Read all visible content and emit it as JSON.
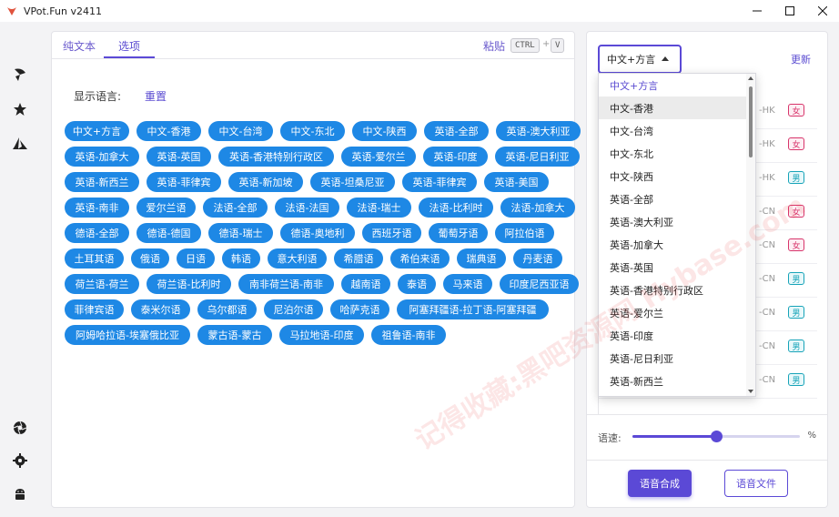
{
  "window": {
    "title": "VPot.Fun v2411",
    "controls": [
      "minimize",
      "maximize",
      "close"
    ]
  },
  "rail": {
    "icons": [
      "pinwheel-icon",
      "star-icon",
      "azure-icon",
      "aperture-icon",
      "gear-icon",
      "android-icon"
    ]
  },
  "main": {
    "tabs": [
      {
        "label": "纯文本"
      },
      {
        "label": "选项"
      }
    ],
    "paste_label": "粘贴",
    "paste_keys": [
      "CTRL",
      "V"
    ],
    "paste_plus": "+",
    "display_language_label": "显示语言:",
    "reset_label": "重置",
    "chips": [
      [
        "中文+方言",
        "中文-香港",
        "中文-台湾",
        "中文-东北",
        "中文-陕西",
        "英语-全部",
        "英语-澳大利亚"
      ],
      [
        "英语-加拿大",
        "英语-英国",
        "英语-香港特别行政区",
        "英语-爱尔兰",
        "英语-印度",
        "英语-尼日利亚"
      ],
      [
        "英语-新西兰",
        "英语-菲律宾",
        "英语-新加坡",
        "英语-坦桑尼亚",
        "英语-菲律宾",
        "英语-美国"
      ],
      [
        "英语-南非",
        "爱尔兰语",
        "法语-全部",
        "法语-法国",
        "法语-瑞士",
        "法语-比利时",
        "法语-加拿大"
      ],
      [
        "德语-全部",
        "德语-德国",
        "德语-瑞士",
        "德语-奥地利",
        "西班牙语",
        "葡萄牙语",
        "阿拉伯语"
      ],
      [
        "土耳其语",
        "俄语",
        "日语",
        "韩语",
        "意大利语",
        "希腊语",
        "希伯来语",
        "瑞典语",
        "丹麦语"
      ],
      [
        "荷兰语-荷兰",
        "荷兰语-比利时",
        "南非荷兰语-南非",
        "越南语",
        "泰语",
        "马来语",
        "印度尼西亚语"
      ],
      [
        "菲律宾语",
        "泰米尔语",
        "乌尔都语",
        "尼泊尔语",
        "哈萨克语",
        "阿塞拜疆语-拉丁语-阿塞拜疆"
      ],
      [
        "阿姆哈拉语-埃塞俄比亚",
        "蒙古语-蒙古",
        "马拉地语-印度",
        "祖鲁语-南非"
      ]
    ]
  },
  "right": {
    "select_value": "中文+方言",
    "update_label": "更新",
    "voices": [
      {
        "code": "-HK",
        "gender": "女",
        "g": "f"
      },
      {
        "code": "-HK",
        "gender": "女",
        "g": "f"
      },
      {
        "code": "-HK",
        "gender": "男",
        "g": "m"
      },
      {
        "code": "-CN",
        "gender": "女",
        "g": "f"
      },
      {
        "code": "-CN",
        "gender": "女",
        "g": "f"
      },
      {
        "code": "-CN",
        "gender": "男",
        "g": "m"
      },
      {
        "code": "-CN",
        "gender": "男",
        "g": "m"
      },
      {
        "code": "-CN",
        "gender": "男",
        "g": "m"
      },
      {
        "code": "-CN",
        "gender": "男",
        "g": "m"
      }
    ],
    "speed_label": "语速:",
    "speed_unit": "%",
    "speed_value_fraction": 0.5,
    "synthesize_label": "语音合成",
    "file_label": "语音文件"
  },
  "dropdown": {
    "items": [
      "中文+方言",
      "中文-香港",
      "中文-台湾",
      "中文-东北",
      "中文-陕西",
      "英语-全部",
      "英语-澳大利亚",
      "英语-加拿大",
      "英语-英国",
      "英语-香港特别行政区",
      "英语-爱尔兰",
      "英语-印度",
      "英语-尼日利亚",
      "英语-新西兰"
    ],
    "selected_index": 0,
    "hover_index": 1
  },
  "watermark": "记得收藏:黑吧资源网 Hybase.com",
  "colors": {
    "accent": "#5b49d6",
    "chip": "#1e88e5",
    "female": "#d8356b",
    "male": "#16a3b8"
  }
}
